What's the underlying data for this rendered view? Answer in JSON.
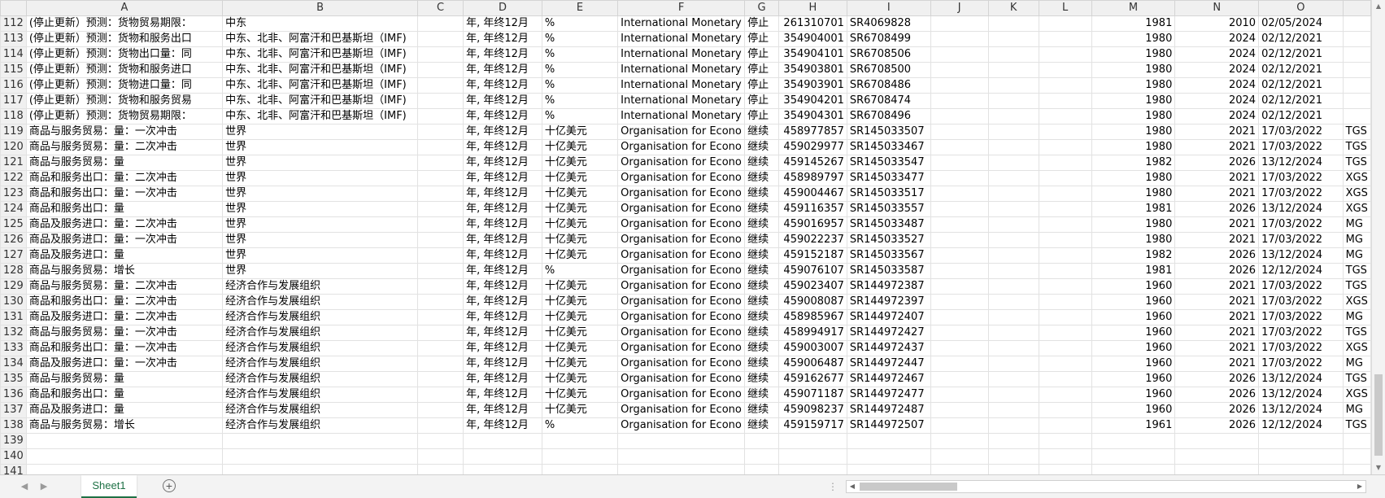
{
  "columns": [
    "A",
    "B",
    "C",
    "D",
    "E",
    "F",
    "G",
    "H",
    "I",
    "J",
    "K",
    "L",
    "M",
    "N",
    "O",
    ""
  ],
  "rows": [
    {
      "n": "112",
      "c": [
        "(停止更新）预测：货物贸易期限：",
        "中东",
        "",
        "年, 年终12月",
        "%",
        "International Monetary",
        "停止",
        "261310701",
        "SR4069828",
        "",
        "",
        "",
        "1981",
        "2010",
        "02/05/2024",
        ""
      ]
    },
    {
      "n": "113",
      "c": [
        "(停止更新）预测：货物和服务出口",
        "中东、北非、阿富汗和巴基斯坦（IMF)",
        "",
        "年, 年终12月",
        "%",
        "International Monetary",
        "停止",
        "354904001",
        "SR6708499",
        "",
        "",
        "",
        "1980",
        "2024",
        "02/12/2021",
        ""
      ]
    },
    {
      "n": "114",
      "c": [
        "(停止更新）预测：货物出口量：同",
        "中东、北非、阿富汗和巴基斯坦（IMF)",
        "",
        "年, 年终12月",
        "%",
        "International Monetary",
        "停止",
        "354904101",
        "SR6708506",
        "",
        "",
        "",
        "1980",
        "2024",
        "02/12/2021",
        ""
      ]
    },
    {
      "n": "115",
      "c": [
        "(停止更新）预测：货物和服务进口",
        "中东、北非、阿富汗和巴基斯坦（IMF)",
        "",
        "年, 年终12月",
        "%",
        "International Monetary",
        "停止",
        "354903801",
        "SR6708500",
        "",
        "",
        "",
        "1980",
        "2024",
        "02/12/2021",
        ""
      ]
    },
    {
      "n": "116",
      "c": [
        "(停止更新）预测：货物进口量：同",
        "中东、北非、阿富汗和巴基斯坦（IMF)",
        "",
        "年, 年终12月",
        "%",
        "International Monetary",
        "停止",
        "354903901",
        "SR6708486",
        "",
        "",
        "",
        "1980",
        "2024",
        "02/12/2021",
        ""
      ]
    },
    {
      "n": "117",
      "c": [
        "(停止更新）预测：货物和服务贸易",
        "中东、北非、阿富汗和巴基斯坦（IMF)",
        "",
        "年, 年终12月",
        "%",
        "International Monetary",
        "停止",
        "354904201",
        "SR6708474",
        "",
        "",
        "",
        "1980",
        "2024",
        "02/12/2021",
        ""
      ]
    },
    {
      "n": "118",
      "c": [
        "(停止更新）预测：货物贸易期限：",
        "中东、北非、阿富汗和巴基斯坦（IMF)",
        "",
        "年, 年终12月",
        "%",
        "International Monetary",
        "停止",
        "354904301",
        "SR6708496",
        "",
        "",
        "",
        "1980",
        "2024",
        "02/12/2021",
        ""
      ]
    },
    {
      "n": "119",
      "c": [
        "商品与服务贸易：量：一次冲击",
        "世界",
        "",
        "年, 年终12月",
        "十亿美元",
        "Organisation for Econo",
        "继续",
        "458977857",
        "SR145033507",
        "",
        "",
        "",
        "1980",
        "2021",
        "17/03/2022",
        "TGS"
      ]
    },
    {
      "n": "120",
      "c": [
        "商品与服务贸易：量：二次冲击",
        "世界",
        "",
        "年, 年终12月",
        "十亿美元",
        "Organisation for Econo",
        "继续",
        "459029977",
        "SR145033467",
        "",
        "",
        "",
        "1980",
        "2021",
        "17/03/2022",
        "TGS"
      ]
    },
    {
      "n": "121",
      "c": [
        "商品与服务贸易：量",
        "世界",
        "",
        "年, 年终12月",
        "十亿美元",
        "Organisation for Econo",
        "继续",
        "459145267",
        "SR145033547",
        "",
        "",
        "",
        "1982",
        "2026",
        "13/12/2024",
        "TGS"
      ]
    },
    {
      "n": "122",
      "c": [
        "商品和服务出口：量：二次冲击",
        "世界",
        "",
        "年, 年终12月",
        "十亿美元",
        "Organisation for Econo",
        "继续",
        "458989797",
        "SR145033477",
        "",
        "",
        "",
        "1980",
        "2021",
        "17/03/2022",
        "XGS"
      ]
    },
    {
      "n": "123",
      "c": [
        "商品和服务出口：量：一次冲击",
        "世界",
        "",
        "年, 年终12月",
        "十亿美元",
        "Organisation for Econo",
        "继续",
        "459004467",
        "SR145033517",
        "",
        "",
        "",
        "1980",
        "2021",
        "17/03/2022",
        "XGS"
      ]
    },
    {
      "n": "124",
      "c": [
        "商品和服务出口：量",
        "世界",
        "",
        "年, 年终12月",
        "十亿美元",
        "Organisation for Econo",
        "继续",
        "459116357",
        "SR145033557",
        "",
        "",
        "",
        "1981",
        "2026",
        "13/12/2024",
        "XGS"
      ]
    },
    {
      "n": "125",
      "c": [
        "商品及服务进口：量：二次冲击",
        "世界",
        "",
        "年, 年终12月",
        "十亿美元",
        "Organisation for Econo",
        "继续",
        "459016957",
        "SR145033487",
        "",
        "",
        "",
        "1980",
        "2021",
        "17/03/2022",
        "MG"
      ]
    },
    {
      "n": "126",
      "c": [
        "商品及服务进口：量：一次冲击",
        "世界",
        "",
        "年, 年终12月",
        "十亿美元",
        "Organisation for Econo",
        "继续",
        "459022237",
        "SR145033527",
        "",
        "",
        "",
        "1980",
        "2021",
        "17/03/2022",
        "MG"
      ]
    },
    {
      "n": "127",
      "c": [
        "商品及服务进口：量",
        "世界",
        "",
        "年, 年终12月",
        "十亿美元",
        "Organisation for Econo",
        "继续",
        "459152187",
        "SR145033567",
        "",
        "",
        "",
        "1982",
        "2026",
        "13/12/2024",
        "MG"
      ]
    },
    {
      "n": "128",
      "c": [
        "商品与服务贸易：增长",
        "世界",
        "",
        "年, 年终12月",
        "%",
        "Organisation for Econo",
        "继续",
        "459076107",
        "SR145033587",
        "",
        "",
        "",
        "1981",
        "2026",
        "12/12/2024",
        "TGS"
      ]
    },
    {
      "n": "129",
      "c": [
        "商品与服务贸易：量：二次冲击",
        "经济合作与发展组织",
        "",
        "年, 年终12月",
        "十亿美元",
        "Organisation for Econo",
        "继续",
        "459023407",
        "SR144972387",
        "",
        "",
        "",
        "1960",
        "2021",
        "17/03/2022",
        "TGS"
      ]
    },
    {
      "n": "130",
      "c": [
        "商品和服务出口：量：二次冲击",
        "经济合作与发展组织",
        "",
        "年, 年终12月",
        "十亿美元",
        "Organisation for Econo",
        "继续",
        "459008087",
        "SR144972397",
        "",
        "",
        "",
        "1960",
        "2021",
        "17/03/2022",
        "XGS"
      ]
    },
    {
      "n": "131",
      "c": [
        "商品及服务进口：量：二次冲击",
        "经济合作与发展组织",
        "",
        "年, 年终12月",
        "十亿美元",
        "Organisation for Econo",
        "继续",
        "458985967",
        "SR144972407",
        "",
        "",
        "",
        "1960",
        "2021",
        "17/03/2022",
        "MG"
      ]
    },
    {
      "n": "132",
      "c": [
        "商品与服务贸易：量：一次冲击",
        "经济合作与发展组织",
        "",
        "年, 年终12月",
        "十亿美元",
        "Organisation for Econo",
        "继续",
        "458994917",
        "SR144972427",
        "",
        "",
        "",
        "1960",
        "2021",
        "17/03/2022",
        "TGS"
      ]
    },
    {
      "n": "133",
      "c": [
        "商品和服务出口：量：一次冲击",
        "经济合作与发展组织",
        "",
        "年, 年终12月",
        "十亿美元",
        "Organisation for Econo",
        "继续",
        "459003007",
        "SR144972437",
        "",
        "",
        "",
        "1960",
        "2021",
        "17/03/2022",
        "XGS"
      ]
    },
    {
      "n": "134",
      "c": [
        "商品及服务进口：量：一次冲击",
        "经济合作与发展组织",
        "",
        "年, 年终12月",
        "十亿美元",
        "Organisation for Econo",
        "继续",
        "459006487",
        "SR144972447",
        "",
        "",
        "",
        "1960",
        "2021",
        "17/03/2022",
        "MG"
      ]
    },
    {
      "n": "135",
      "c": [
        "商品与服务贸易：量",
        "经济合作与发展组织",
        "",
        "年, 年终12月",
        "十亿美元",
        "Organisation for Econo",
        "继续",
        "459162677",
        "SR144972467",
        "",
        "",
        "",
        "1960",
        "2026",
        "13/12/2024",
        "TGS"
      ]
    },
    {
      "n": "136",
      "c": [
        "商品和服务出口：量",
        "经济合作与发展组织",
        "",
        "年, 年终12月",
        "十亿美元",
        "Organisation for Econo",
        "继续",
        "459071187",
        "SR144972477",
        "",
        "",
        "",
        "1960",
        "2026",
        "13/12/2024",
        "XGS"
      ]
    },
    {
      "n": "137",
      "c": [
        "商品及服务进口：量",
        "经济合作与发展组织",
        "",
        "年, 年终12月",
        "十亿美元",
        "Organisation for Econo",
        "继续",
        "459098237",
        "SR144972487",
        "",
        "",
        "",
        "1960",
        "2026",
        "13/12/2024",
        "MG"
      ]
    },
    {
      "n": "138",
      "c": [
        "商品与服务贸易：增长",
        "经济合作与发展组织",
        "",
        "年, 年终12月",
        "%",
        "Organisation for Econo",
        "继续",
        "459159717",
        "SR144972507",
        "",
        "",
        "",
        "1961",
        "2026",
        "12/12/2024",
        "TGS"
      ]
    },
    {
      "n": "139",
      "c": [
        "",
        "",
        "",
        "",
        "",
        "",
        "",
        "",
        "",
        "",
        "",
        "",
        "",
        "",
        "",
        ""
      ]
    },
    {
      "n": "140",
      "c": [
        "",
        "",
        "",
        "",
        "",
        "",
        "",
        "",
        "",
        "",
        "",
        "",
        "",
        "",
        "",
        ""
      ]
    },
    {
      "n": "141",
      "c": [
        "",
        "",
        "",
        "",
        "",
        "",
        "",
        "",
        "",
        "",
        "",
        "",
        "",
        "",
        "",
        ""
      ]
    }
  ],
  "sheet_tab": "Sheet1",
  "add_sheet_symbol": "+",
  "nav_prev_symbol": "◀",
  "nav_next_symbol": "▶",
  "splitter_symbol": "⋮",
  "scroll_up_symbol": "▲",
  "scroll_down_symbol": "▼",
  "scroll_left_symbol": "◀",
  "scroll_right_symbol": "▶",
  "accent_color": "#1e7145"
}
